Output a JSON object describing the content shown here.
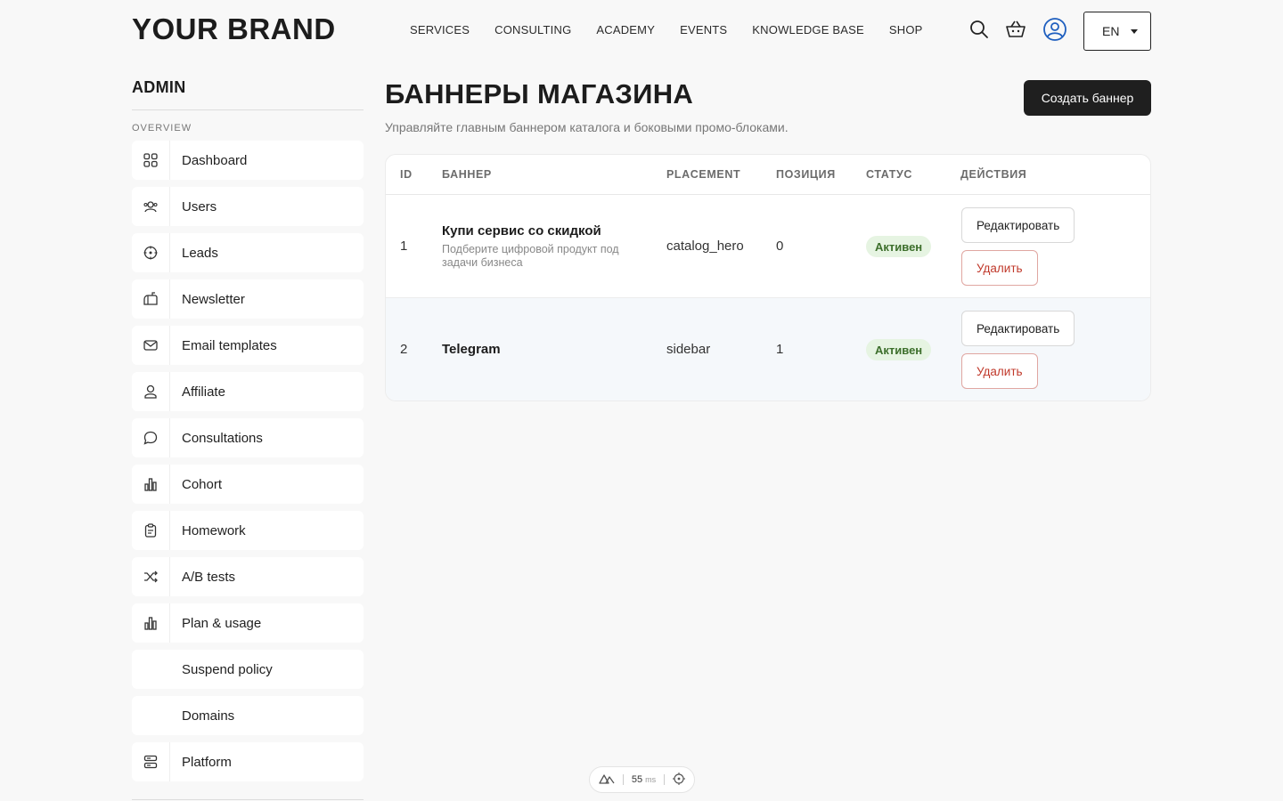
{
  "header": {
    "brand": "YOUR BRAND",
    "nav": [
      "SERVICES",
      "CONSULTING",
      "ACADEMY",
      "EVENTS",
      "KNOWLEDGE BASE",
      "SHOP"
    ],
    "language": "EN",
    "icons": [
      "search-icon",
      "basket-icon",
      "user-icon"
    ]
  },
  "sidebar": {
    "title": "ADMIN",
    "section": "OVERVIEW",
    "items": [
      {
        "label": "Dashboard",
        "icon": "grid-icon"
      },
      {
        "label": "Users",
        "icon": "users-icon"
      },
      {
        "label": "Leads",
        "icon": "target-icon"
      },
      {
        "label": "Newsletter",
        "icon": "mailbox-icon"
      },
      {
        "label": "Email templates",
        "icon": "envelope-icon"
      },
      {
        "label": "Affiliate",
        "icon": "affiliate-icon"
      },
      {
        "label": "Consultations",
        "icon": "chat-icon"
      },
      {
        "label": "Cohort",
        "icon": "chart-icon"
      },
      {
        "label": "Homework",
        "icon": "clipboard-icon"
      },
      {
        "label": "A/B tests",
        "icon": "shuffle-icon"
      },
      {
        "label": "Plan & usage",
        "icon": "chart-icon"
      },
      {
        "label": "Suspend policy",
        "icon": ""
      },
      {
        "label": "Domains",
        "icon": ""
      },
      {
        "label": "Platform",
        "icon": "server-icon"
      }
    ]
  },
  "main": {
    "title": "БАННЕРЫ МАГАЗИНА",
    "subtitle": "Управляйте главным баннером каталога и боковыми промо-блоками.",
    "create_button": "Создать баннер",
    "table": {
      "headers": [
        "ID",
        "БАННЕР",
        "PLACEMENT",
        "ПОЗИЦИЯ",
        "СТАТУС",
        "ДЕЙСТВИЯ"
      ],
      "rows": [
        {
          "id": "1",
          "title": "Купи сервис со скидкой",
          "description": "Подберите цифровой продукт под задачи бизнеса",
          "placement": "catalog_hero",
          "position": "0",
          "status": "Активен",
          "edit": "Редактировать",
          "delete": "Удалить"
        },
        {
          "id": "2",
          "title": "Telegram",
          "description": "",
          "placement": "sidebar",
          "position": "1",
          "status": "Активен",
          "edit": "Редактировать",
          "delete": "Удалить"
        }
      ]
    }
  },
  "devbar": {
    "ms_value": "55",
    "ms_unit": "ms"
  },
  "colors": {
    "accent": "#1f1f1f",
    "status_bg": "#e6f4e2",
    "status_text": "#3d6f2c",
    "delete": "#c0392b"
  }
}
